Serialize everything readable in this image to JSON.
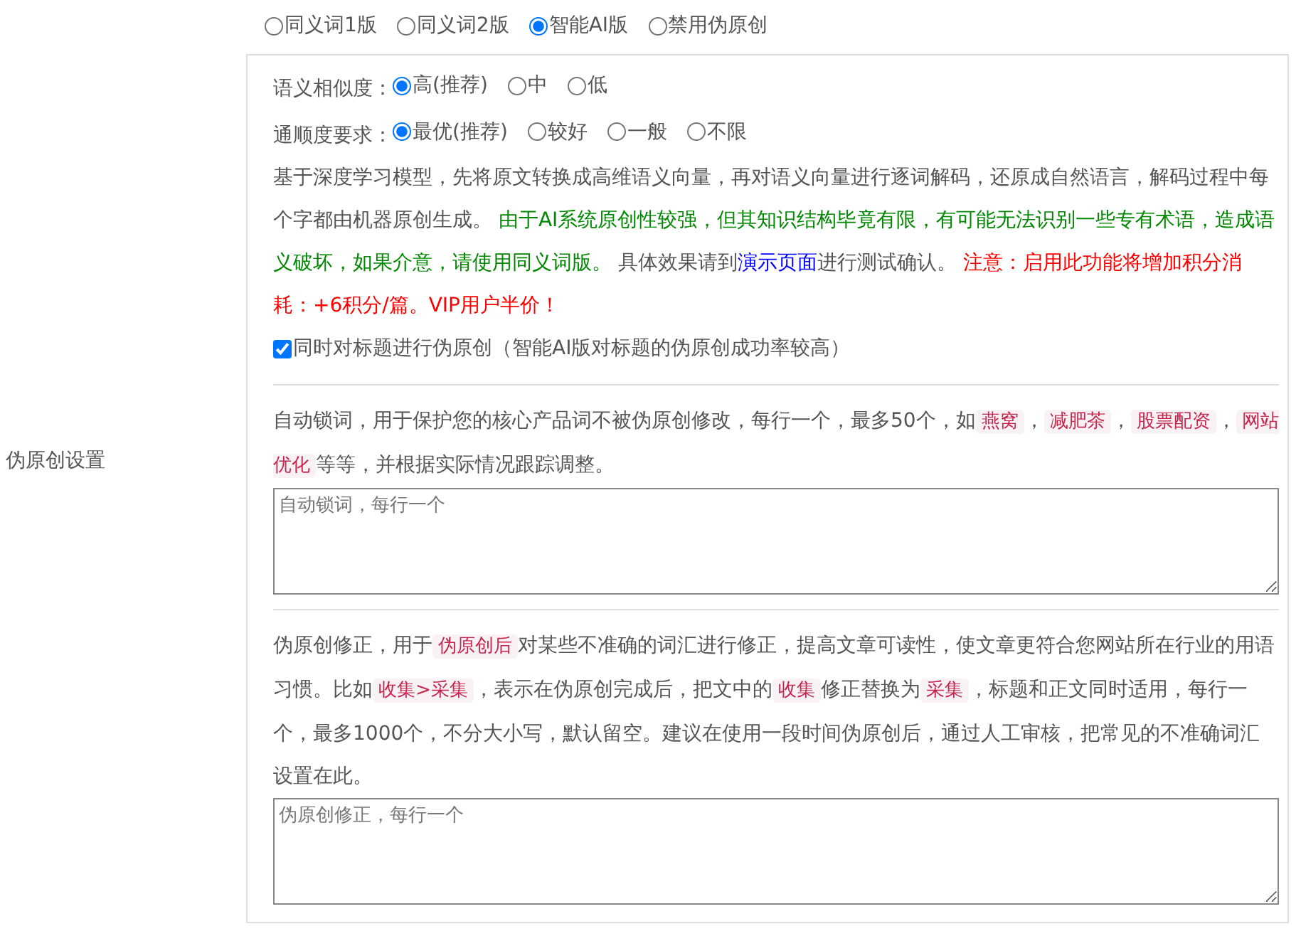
{
  "side_label": "伪原创设置",
  "mode_options": [
    {
      "label": "同义词1版",
      "selected": false
    },
    {
      "label": "同义词2版",
      "selected": false
    },
    {
      "label": "智能AI版",
      "selected": true
    },
    {
      "label": "禁用伪原创",
      "selected": false
    }
  ],
  "similarity": {
    "label": "语义相似度：",
    "options": [
      {
        "label": "高(推荐)",
        "selected": true
      },
      {
        "label": "中",
        "selected": false
      },
      {
        "label": "低",
        "selected": false
      }
    ]
  },
  "fluency": {
    "label": "通顺度要求：",
    "options": [
      {
        "label": "最优(推荐)",
        "selected": true
      },
      {
        "label": "较好",
        "selected": false
      },
      {
        "label": "一般",
        "selected": false
      },
      {
        "label": "不限",
        "selected": false
      }
    ]
  },
  "description": [
    {
      "kind": "plain",
      "text": "基于深度学习模型，先将原文转换成高维语义向量，再对语义向量进行逐词解码，还原成自然语言，解码过程中每个字都由机器原创生成。 "
    },
    {
      "kind": "green",
      "text": "由于AI系统原创性较强，但其知识结构毕竟有限，有可能无法识别一些专有术语，造成语义破坏，如果介意，请使用同义词版。"
    },
    {
      "kind": "plain",
      "text": " 具体效果请到"
    },
    {
      "kind": "link",
      "text": "演示页面"
    },
    {
      "kind": "plain",
      "text": "进行测试确认。 "
    },
    {
      "kind": "red",
      "text": "注意：启用此功能将增加积分消耗：+6积分/篇。VIP用户半价！"
    }
  ],
  "title_option": {
    "label": "同时对标题进行伪原创（智能AI版对标题的伪原创成功率较高）",
    "checked": true
  },
  "lock_words": {
    "segments": [
      {
        "kind": "plain",
        "text": "自动锁词，用于保护您的核心产品词不被伪原创修改，每行一个，最多50个，如"
      },
      {
        "kind": "code",
        "text": "燕窝"
      },
      {
        "kind": "plain",
        "text": "，"
      },
      {
        "kind": "code",
        "text": "减肥茶"
      },
      {
        "kind": "plain",
        "text": "，"
      },
      {
        "kind": "code",
        "text": "股票配资"
      },
      {
        "kind": "plain",
        "text": "，"
      },
      {
        "kind": "code",
        "text": "网站优化"
      },
      {
        "kind": "plain",
        "text": "等等，并根据实际情况跟踪调整。"
      }
    ],
    "placeholder": "自动锁词，每行一个"
  },
  "correction": {
    "segments": [
      {
        "kind": "plain",
        "text": "伪原创修正，用于"
      },
      {
        "kind": "code",
        "text": "伪原创后"
      },
      {
        "kind": "plain",
        "text": "对某些不准确的词汇进行修正，提高文章可读性，使文章更符合您网站所在行业的用语习惯。比如"
      },
      {
        "kind": "code",
        "text": "收集>采集"
      },
      {
        "kind": "plain",
        "text": "，表示在伪原创完成后，把文中的"
      },
      {
        "kind": "code",
        "text": "收集"
      },
      {
        "kind": "plain",
        "text": "修正替换为"
      },
      {
        "kind": "code",
        "text": "采集"
      },
      {
        "kind": "plain",
        "text": "，标题和正文同时适用，每行一个，最多1000个，不分大小写，默认留空。建议在使用一段时间伪原创后，通过人工审核，把常见的不准确词汇设置在此。"
      }
    ],
    "placeholder": "伪原创修正，每行一个"
  }
}
